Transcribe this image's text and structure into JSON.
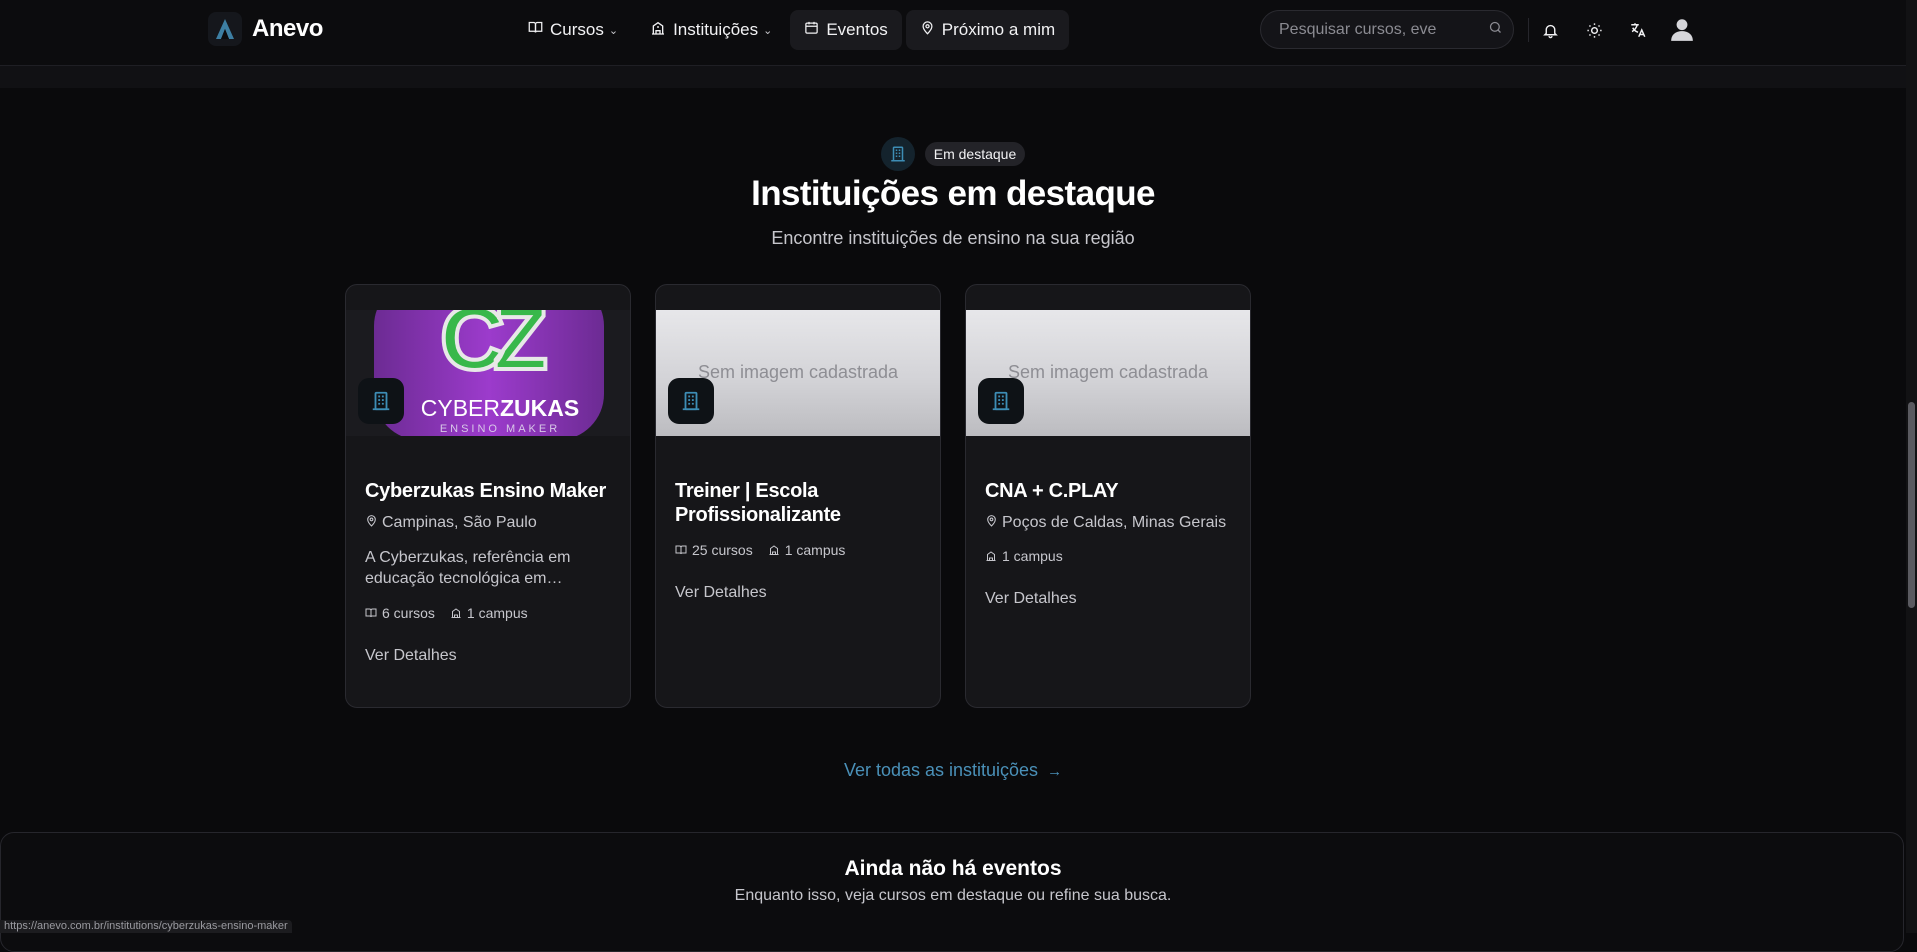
{
  "app": {
    "name": "Anevo"
  },
  "nav": {
    "items": [
      {
        "label": "Cursos",
        "icon": "book-open-icon",
        "dropdown": true
      },
      {
        "label": "Instituições",
        "icon": "school-icon",
        "dropdown": true
      },
      {
        "label": "Eventos",
        "icon": "calendar-icon",
        "dropdown": false
      },
      {
        "label": "Próximo a mim",
        "icon": "map-pin-icon",
        "dropdown": false
      }
    ]
  },
  "search": {
    "placeholder": "Pesquisar cursos, eve"
  },
  "header_icons": [
    "bell-icon",
    "sun-icon",
    "translate-icon",
    "user-avatar-icon"
  ],
  "section": {
    "badge": "Em destaque",
    "title": "Instituições em destaque",
    "subtitle": "Encontre instituições de ensino na sua região"
  },
  "cards": [
    {
      "name": "Cyberzukas Ensino Maker",
      "location": "Campinas, São Paulo",
      "description": "A Cyberzukas, referência em educação tecnológica em…",
      "courses": "6 cursos",
      "campus": "1 campus",
      "details": "Ver Detalhes",
      "image": {
        "letters": "CZ",
        "brand_light": "CYBER",
        "brand_bold": "ZUKAS",
        "tagline": "ENSINO MAKER"
      }
    },
    {
      "name": "Treiner | Escola Profissionalizante",
      "courses": "25 cursos",
      "campus": "1 campus",
      "details": "Ver Detalhes",
      "image_placeholder": "Sem imagem cadastrada"
    },
    {
      "name": "CNA + C.PLAY",
      "location": "Poços de Caldas, Minas Gerais",
      "campus": "1 campus",
      "details": "Ver Detalhes",
      "image_placeholder": "Sem imagem cadastrada"
    }
  ],
  "see_all": "Ver todas as instituições",
  "events": {
    "title": "Ainda não há eventos",
    "subtitle": "Enquanto isso, veja cursos em destaque ou refine sua busca."
  },
  "status_url": "https://anevo.com.br/institutions/cyberzukas-ensino-maker",
  "colors": {
    "accent": "#4a90b8",
    "background": "#0a0a0c",
    "card": "#161619"
  }
}
